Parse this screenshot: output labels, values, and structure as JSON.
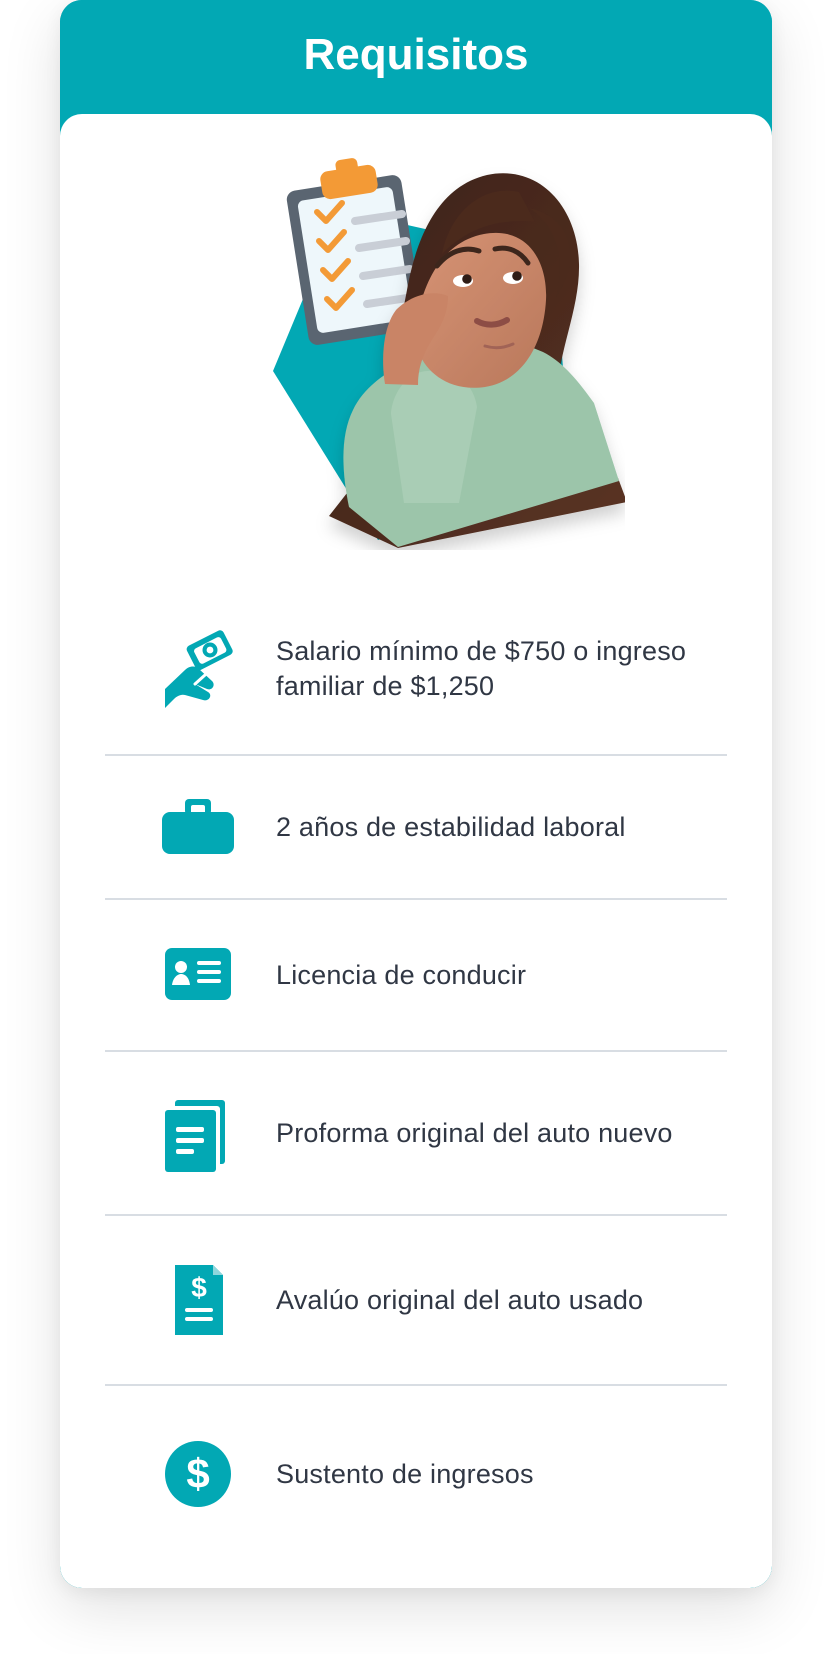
{
  "header": {
    "title": "Requisitos"
  },
  "colors": {
    "accent": "#02a8b4",
    "text": "#303744",
    "divider": "#d8dde3",
    "clipboard_orange": "#f39a36",
    "shirt": "#9cc5aa"
  },
  "hero": {
    "image": "woman-thinking-with-checklist"
  },
  "requirements": [
    {
      "icon": "money-hand-icon",
      "label": "Salario mínimo de $750 o ingreso familiar de $1,250"
    },
    {
      "icon": "briefcase-icon",
      "label": "2 años de estabilidad laboral"
    },
    {
      "icon": "id-card-icon",
      "label": "Licencia de conducir"
    },
    {
      "icon": "document-stack-icon",
      "label": "Proforma original del auto nuevo"
    },
    {
      "icon": "price-document-icon",
      "label": "Avalúo original del auto usado"
    },
    {
      "icon": "dollar-circle-icon",
      "label": "Sustento de ingresos"
    }
  ]
}
